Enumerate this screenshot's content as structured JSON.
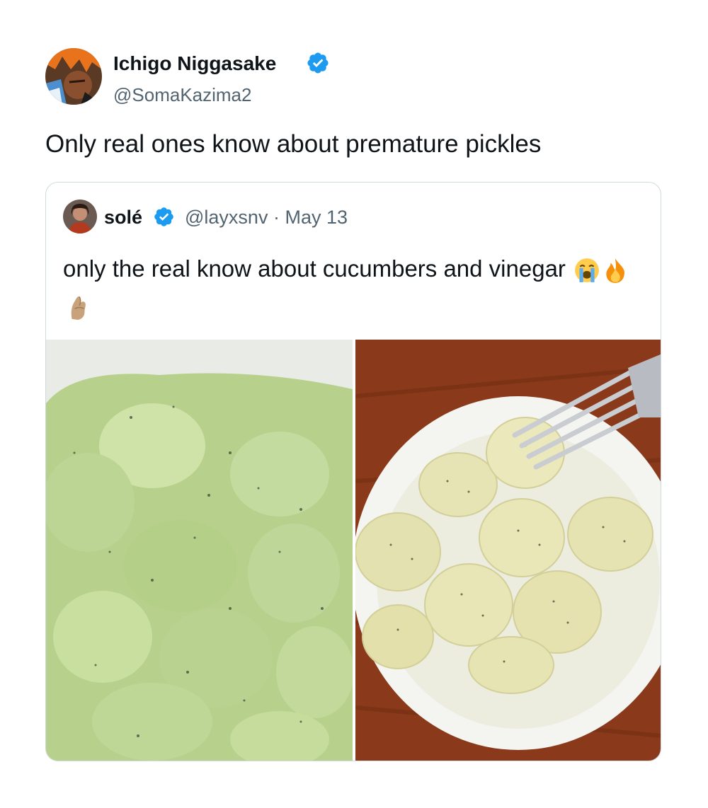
{
  "tweet": {
    "author": {
      "name": "Ichigo Niggasake",
      "handle": "@SomaKazima2",
      "verified": true
    },
    "text": "Only real ones know about premature pickles"
  },
  "quoted_tweet": {
    "author": {
      "name": "solé",
      "handle": "@layxsnv",
      "verified": true
    },
    "separator": "·",
    "date": "May 13",
    "text": "only the real know about cucumbers and vinegar",
    "emojis": [
      "loudly-crying-face-emoji",
      "fire-emoji",
      "pinched-fingers-emoji"
    ],
    "photos": [
      "cucumber-slices-in-vinegar-photo",
      "cucumber-slices-bowl-with-fork-photo"
    ]
  },
  "colors": {
    "verified": "#1d9bf0",
    "text": "#0f1419",
    "secondary": "#536471",
    "border": "#cfd9de"
  }
}
